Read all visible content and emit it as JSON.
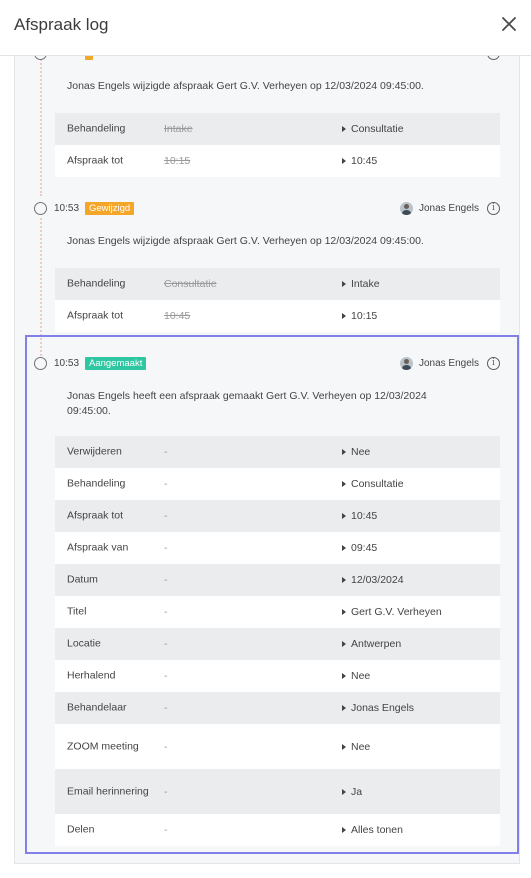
{
  "header": {
    "title": "Afspraak log"
  },
  "colors": {
    "badge_orange": "#f4a628",
    "badge_green": "#2ec7a2",
    "highlight": "#8080e8"
  },
  "entries": [
    {
      "time": "",
      "badge": "",
      "user": "",
      "description": "Jonas Engels wijzigde afspraak Gert G.V. Verheyen op 12/03/2024 09:45:00.",
      "rows": [
        {
          "field": "Behandeling",
          "old": "Intake",
          "new": "Consultatie"
        },
        {
          "field": "Afspraak tot",
          "old": "10:15",
          "new": "10:45"
        }
      ]
    },
    {
      "time": "10:53",
      "badge": "Gewijzigd",
      "user": "Jonas Engels",
      "description": "Jonas Engels wijzigde afspraak Gert G.V. Verheyen op 12/03/2024 09:45:00.",
      "rows": [
        {
          "field": "Behandeling",
          "old": "Consultatie",
          "new": "Intake"
        },
        {
          "field": "Afspraak tot",
          "old": "10:45",
          "new": "10:15"
        }
      ]
    },
    {
      "time": "10:53",
      "badge": "Aangemaakt",
      "user": "Jonas Engels",
      "description": "Jonas Engels heeft een afspraak gemaakt Gert G.V. Verheyen op 12/03/2024 09:45:00.",
      "rows": [
        {
          "field": "Verwijderen",
          "old": "-",
          "new": "Nee"
        },
        {
          "field": "Behandeling",
          "old": "-",
          "new": "Consultatie"
        },
        {
          "field": "Afspraak tot",
          "old": "-",
          "new": "10:45"
        },
        {
          "field": "Afspraak van",
          "old": "-",
          "new": "09:45"
        },
        {
          "field": "Datum",
          "old": "-",
          "new": "12/03/2024"
        },
        {
          "field": "Titel",
          "old": "-",
          "new": "Gert G.V. Verheyen"
        },
        {
          "field": "Locatie",
          "old": "-",
          "new": "Antwerpen"
        },
        {
          "field": "Herhalend",
          "old": "-",
          "new": "Nee"
        },
        {
          "field": "Behandelaar",
          "old": "-",
          "new": "Jonas Engels"
        },
        {
          "field": "ZOOM meeting",
          "old": "-",
          "new": "Nee"
        },
        {
          "field": "Email herinnering",
          "old": "-",
          "new": "Ja"
        },
        {
          "field": "Delen",
          "old": "-",
          "new": "Alles tonen"
        }
      ]
    }
  ]
}
